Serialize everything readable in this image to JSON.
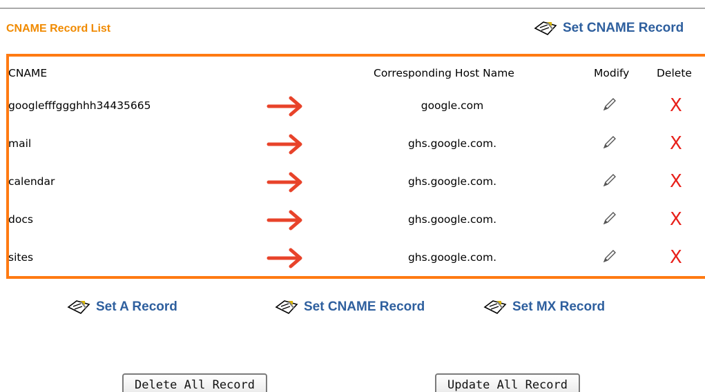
{
  "header": {
    "list_title": "CNAME Record List",
    "set_cname_link": "Set CNAME Record"
  },
  "table": {
    "columns": [
      "CNAME",
      "Corresponding Host Name",
      "Modify",
      "Delete"
    ],
    "rows": [
      {
        "cname": "googlefffggghhh34435665",
        "host": "google.com"
      },
      {
        "cname": "mail",
        "host": "ghs.google.com."
      },
      {
        "cname": "calendar",
        "host": "ghs.google.com."
      },
      {
        "cname": "docs",
        "host": "ghs.google.com."
      },
      {
        "cname": "sites",
        "host": "ghs.google.com."
      }
    ],
    "delete_glyph": "X"
  },
  "links": {
    "set_a": "Set A Record",
    "set_cname": "Set CNAME Record",
    "set_mx": "Set MX Record"
  },
  "buttons": {
    "delete_all": "Delete All Record",
    "update_all": "Update All Record"
  },
  "colors": {
    "title": "#f08a00",
    "box_border": "#ff7a12",
    "link": "#2e5f9e",
    "arrow": "#e8432a",
    "delete": "#e8201a"
  },
  "icons": [
    "pencil-icon",
    "edit-note-icon",
    "arrow-right-icon",
    "delete-x-icon"
  ]
}
